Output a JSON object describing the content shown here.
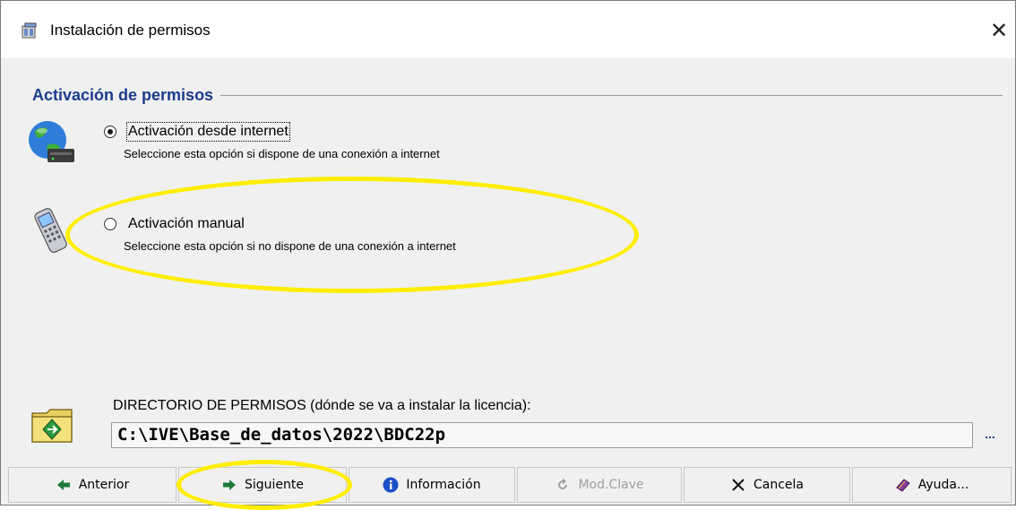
{
  "window": {
    "title": "Instalación de permisos",
    "close_glyph": "✕"
  },
  "section": {
    "title": "Activación de permisos"
  },
  "options": [
    {
      "label": "Activación desde internet",
      "description": "Seleccione esta opción si dispone de una conexión a internet",
      "selected": true,
      "icon": "globe-modem-icon"
    },
    {
      "label": "Activación manual",
      "description": "Seleccione esta opción si no dispone de una conexión a internet",
      "selected": false,
      "icon": "mobile-phone-icon"
    }
  ],
  "directory": {
    "label": "DIRECTORIO DE PERMISOS (dónde se va a instalar la licencia):",
    "value": "C:\\IVE\\Base_de_datos\\2022\\BDC22p",
    "browse_label": "...",
    "icon": "folder-icon"
  },
  "buttons": [
    {
      "label": "Anterior",
      "icon": "arrow-left-icon",
      "enabled": true
    },
    {
      "label": "Siguiente",
      "icon": "arrow-right-icon",
      "enabled": true
    },
    {
      "label": "Información",
      "icon": "info-icon",
      "enabled": true
    },
    {
      "label": "Mod.Clave",
      "icon": "refresh-icon",
      "enabled": false
    },
    {
      "label": "Cancela",
      "icon": "x-icon",
      "enabled": true
    },
    {
      "label": "Ayuda...",
      "icon": "help-book-icon",
      "enabled": true
    }
  ],
  "colors": {
    "section_title": "#1c3c8c",
    "highlight": "#ffee00",
    "background": "#f0f0f0"
  }
}
